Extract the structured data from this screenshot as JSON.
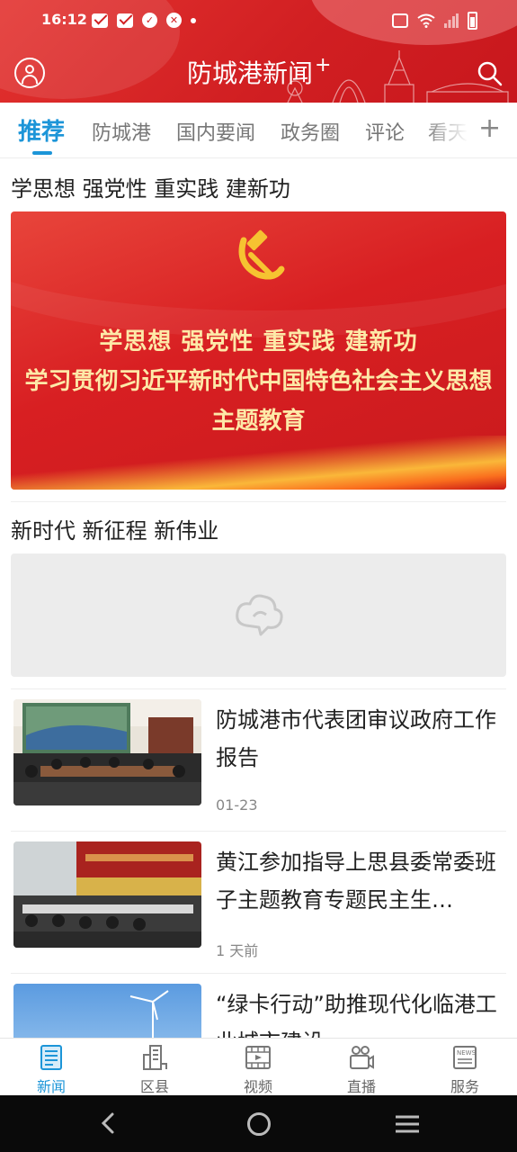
{
  "status_bar": {
    "time": "16:12",
    "notification_icons": [
      "mail-icon",
      "mail-icon",
      "check-badge-icon",
      "shield-icon",
      "dot-icon"
    ],
    "right_icons": [
      "vibrate-icon",
      "wifi-icon",
      "signal-icon",
      "battery-icon"
    ]
  },
  "header": {
    "title": "防城港新闻",
    "title_suffix": "+",
    "colors": {
      "primary_red": "#d11f22",
      "accent_blue": "#1c95d8"
    }
  },
  "tabs": [
    {
      "label": "推荐",
      "active": true
    },
    {
      "label": "防城港",
      "active": false
    },
    {
      "label": "国内要闻",
      "active": false
    },
    {
      "label": "政务圈",
      "active": false
    },
    {
      "label": "评论",
      "active": false
    },
    {
      "label": "看天",
      "active": false
    }
  ],
  "sections": [
    {
      "title": "学思想 强党性 重实践 建新功",
      "banner_lines": [
        "学思想  强党性  重实践  建新功",
        "学习贯彻习近平新时代中国特色社会主义思想",
        "主题教育"
      ]
    },
    {
      "title": "新时代 新征程 新伟业"
    }
  ],
  "news": [
    {
      "title": "防城港市代表团审议政府工作报告",
      "meta": "01-23"
    },
    {
      "title": "黄江参加指导上思县委常委班子主题教育专题民主生…",
      "meta": "1 天前"
    },
    {
      "title": "“绿卡行动”助推现代化临港工业城市建设",
      "meta": ""
    }
  ],
  "bottom_nav": [
    {
      "label": "新闻",
      "icon": "news-icon",
      "active": true
    },
    {
      "label": "区县",
      "icon": "district-icon",
      "active": false
    },
    {
      "label": "视频",
      "icon": "video-icon",
      "active": false
    },
    {
      "label": "直播",
      "icon": "live-icon",
      "active": false
    },
    {
      "label": "服务",
      "icon": "service-icon",
      "active": false
    }
  ]
}
